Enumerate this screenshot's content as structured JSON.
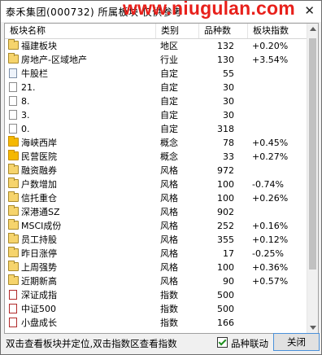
{
  "window": {
    "title": "泰禾集团(000732) 所属板块 仅供参考",
    "watermark": "www.niugulan.com",
    "close_glyph": "✕"
  },
  "table": {
    "columns": [
      "板块名称",
      "类别",
      "品种数",
      "板块指数"
    ],
    "rows": [
      {
        "icon": "folder",
        "name": "福建板块",
        "type": "地区",
        "count": "132",
        "index": "+0.20%"
      },
      {
        "icon": "folder",
        "name": "房地产-区域地产",
        "type": "行业",
        "count": "130",
        "index": "+3.54%"
      },
      {
        "icon": "page-blue",
        "name": "牛股栏",
        "type": "自定",
        "count": "55",
        "index": ""
      },
      {
        "icon": "page",
        "name": "21.",
        "type": "自定",
        "count": "30",
        "index": ""
      },
      {
        "icon": "page",
        "name": "8.",
        "type": "自定",
        "count": "30",
        "index": ""
      },
      {
        "icon": "page",
        "name": "3.",
        "type": "自定",
        "count": "30",
        "index": ""
      },
      {
        "icon": "page",
        "name": "0.",
        "type": "自定",
        "count": "318",
        "index": ""
      },
      {
        "icon": "folder-solid",
        "name": "海峡西岸",
        "type": "概念",
        "count": "78",
        "index": "+0.45%"
      },
      {
        "icon": "folder-solid",
        "name": "民营医院",
        "type": "概念",
        "count": "33",
        "index": "+0.27%"
      },
      {
        "icon": "folder",
        "name": "融资融券",
        "type": "风格",
        "count": "972",
        "index": ""
      },
      {
        "icon": "folder",
        "name": "户数增加",
        "type": "风格",
        "count": "100",
        "index": "-0.74%"
      },
      {
        "icon": "folder",
        "name": "信托重仓",
        "type": "风格",
        "count": "100",
        "index": "+0.26%"
      },
      {
        "icon": "folder",
        "name": "深港通SZ",
        "type": "风格",
        "count": "902",
        "index": ""
      },
      {
        "icon": "folder",
        "name": "MSCI成份",
        "type": "风格",
        "count": "252",
        "index": "+0.16%"
      },
      {
        "icon": "folder",
        "name": "员工持股",
        "type": "风格",
        "count": "355",
        "index": "+0.12%"
      },
      {
        "icon": "folder",
        "name": "昨日涨停",
        "type": "风格",
        "count": "17",
        "index": "-0.25%"
      },
      {
        "icon": "folder",
        "name": "上周强势",
        "type": "风格",
        "count": "100",
        "index": "+0.36%"
      },
      {
        "icon": "folder",
        "name": "近期新高",
        "type": "风格",
        "count": "90",
        "index": "+0.57%"
      },
      {
        "icon": "page-red",
        "name": "深证成指",
        "type": "指数",
        "count": "500",
        "index": ""
      },
      {
        "icon": "page-red",
        "name": "中证500",
        "type": "指数",
        "count": "500",
        "index": ""
      },
      {
        "icon": "page-red",
        "name": "小盘成长",
        "type": "指数",
        "count": "166",
        "index": ""
      }
    ]
  },
  "status": {
    "hint": "双击查看板块并定位,双击指数区查看指数",
    "checkbox_label": "品种联动",
    "checkbox_checked": true,
    "close_label": "关闭"
  }
}
